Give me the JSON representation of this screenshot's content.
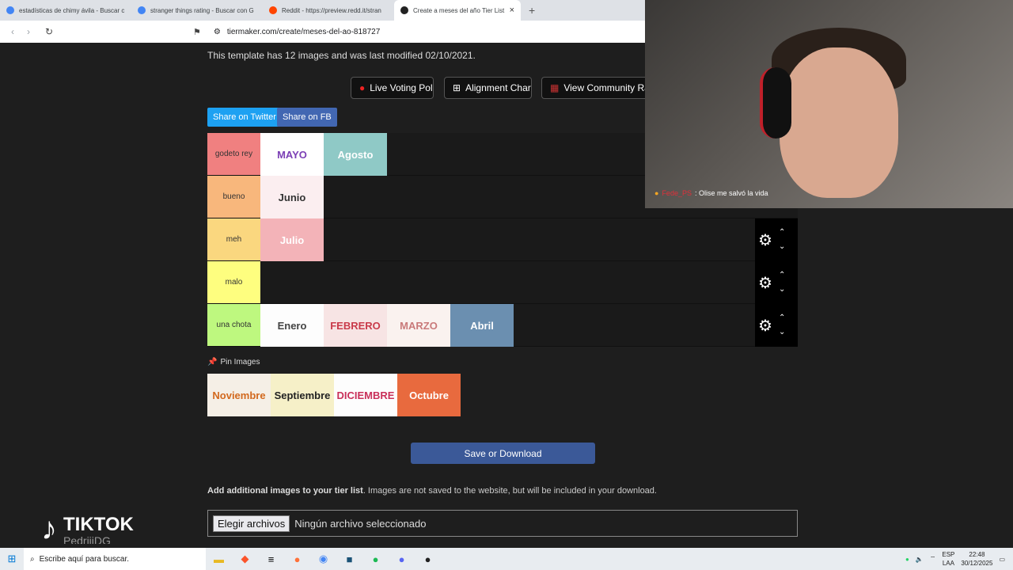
{
  "browser": {
    "tabs": [
      {
        "title": "estadísticas de chimy ávila - Buscar c",
        "active": false,
        "favicon_color": "#4285f4"
      },
      {
        "title": "stranger things rating - Buscar con G",
        "active": false,
        "favicon_color": "#4285f4"
      },
      {
        "title": "Reddit - https://preview.redd.it/stran",
        "active": false,
        "favicon_color": "#ff4500"
      },
      {
        "title": "Create a meses del año Tier List",
        "active": true,
        "favicon_color": "#222222"
      }
    ],
    "new_tab": "+",
    "close_tab": "×",
    "url": "tiermaker.com/create/meses-del-ao-818727"
  },
  "page": {
    "template_info": "This template has 12 images and was last modified 02/10/2021.",
    "buttons": {
      "live_voting": "Live Voting Poll",
      "alignment": "Alignment Chart",
      "community": "View Community Ran"
    },
    "share": {
      "twitter": "Share on Twitter",
      "fb": "Share on FB"
    },
    "tiers": [
      {
        "label": "godeto rey",
        "color": "#f08080",
        "items": [
          {
            "text": "MAYO",
            "bg": "#ffffff",
            "fg": "#7b3fb5"
          },
          {
            "text": "Agosto",
            "bg": "#8fc9c6",
            "fg": "#ffffff"
          }
        ],
        "controls": false
      },
      {
        "label": "bueno",
        "color": "#f8b77c",
        "items": [
          {
            "text": "Junio",
            "bg": "#fbeef0",
            "fg": "#333333"
          }
        ],
        "controls": false
      },
      {
        "label": "meh",
        "color": "#fad77f",
        "items": [
          {
            "text": "Julio",
            "bg": "#f3b3b8",
            "fg": "#ffffff"
          }
        ],
        "controls": true
      },
      {
        "label": "malo",
        "color": "#fefe7f",
        "items": [],
        "controls": true
      },
      {
        "label": "una chota",
        "color": "#bef87f",
        "items": [
          {
            "text": "Enero",
            "bg": "#fdfdfd",
            "fg": "#444444"
          },
          {
            "text": "FEBRERO",
            "bg": "#f7e4e4",
            "fg": "#c93a4a"
          },
          {
            "text": "MARZO",
            "bg": "#faf2ef",
            "fg": "#c97a7a"
          },
          {
            "text": "Abril",
            "bg": "#6b8fb0",
            "fg": "#ffffff"
          }
        ],
        "controls": true
      }
    ],
    "pin_label": "Pin Images",
    "pool": [
      {
        "text": "Noviembre",
        "bg": "#f5efe6",
        "fg": "#d2691e"
      },
      {
        "text": "Septiembre",
        "bg": "#f6f0c8",
        "fg": "#222222"
      },
      {
        "text": "DICIEMBRE",
        "bg": "#fdfdfd",
        "fg": "#c9305a"
      },
      {
        "text": "Octubre",
        "bg": "#e86a3e",
        "fg": "#ffffff"
      }
    ],
    "save_button": "Save or Download",
    "add_images_bold": "Add additional images to your tier list",
    "add_images_text": ". Images are not saved to the website, but will be included in your download.",
    "file_button": "Elegir archivos",
    "file_status": "Ningún archivo seleccionado"
  },
  "stream": {
    "chat_user": "Fede_PS",
    "chat_message": ": Olise me salvó la vida",
    "watermark_brand": "TIKTOK",
    "watermark_user": "PedriiiDG"
  },
  "taskbar": {
    "search_placeholder": "Escribe aquí para buscar.",
    "lang": "ESP",
    "region": "LAA",
    "time": "22:48",
    "date": "30/12/2025"
  }
}
